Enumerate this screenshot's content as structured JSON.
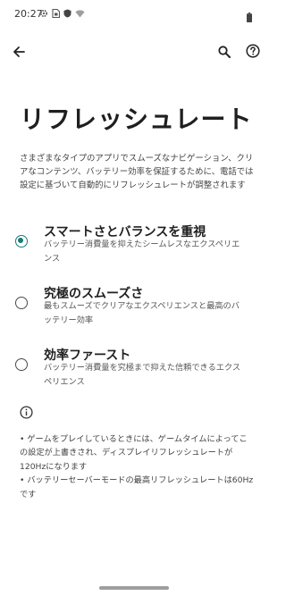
{
  "status_bar": {
    "time": "20:27",
    "icons": [
      "gear-icon",
      "sim-icon",
      "shield-icon",
      "wifi-icon"
    ],
    "battery_icon": "battery-icon"
  },
  "app_bar": {
    "back_icon": "arrow-back-icon",
    "search_icon": "search-icon",
    "help_icon": "help-icon"
  },
  "page": {
    "title": "リフレッシュレート",
    "description": "さまざまなタイプのアプリでスムーズなナビゲーション、クリアなコンテンツ、バッテリー効率を保証するために、電話では設定に基づいて自動的にリフレッシュレートが調整されます"
  },
  "options": [
    {
      "title": "スマートさとバランスを重視",
      "desc": "バッテリー消費量を抑えたシームレスなエクスペリエンス",
      "selected": true
    },
    {
      "title": "究極のスムーズさ",
      "desc": "最もスムーズでクリアなエクスペリエンスと最高のバッテリー効率",
      "selected": false
    },
    {
      "title": "効率ファースト",
      "desc": "バッテリー消費量を究極まで抑えた信頼できるエクスペリエンス",
      "selected": false
    }
  ],
  "notes": [
    "• ゲームをプレイしているときには、ゲームタイムによってこの設定が上書きされ、ディスプレイリフレッシュレートが120Hzになります",
    "• バッテリーセーバーモードの最高リフレッシュレートは60Hzです"
  ],
  "colors": {
    "accent": "#1a7a78",
    "text_primary": "#1f1f1f",
    "text_secondary": "#555555"
  }
}
